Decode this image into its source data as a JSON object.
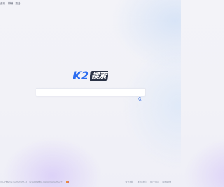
{
  "top_nav": {
    "items": [
      "资讯",
      "热榜",
      "更多"
    ]
  },
  "logo": {
    "brand": "K2",
    "badge": "搜索"
  },
  "search": {
    "value": "",
    "placeholder": ""
  },
  "footer": {
    "icp": "京ICP备2023000000号-3",
    "police": "京公网安备11010000000000号",
    "links": [
      "关于我们",
      "联系我们",
      "用户协议",
      "隐私政策"
    ]
  },
  "colors": {
    "brand_blue": "#2c6df0",
    "badge_dark": "#2b3346",
    "search_icon": "#3a6fe0"
  }
}
